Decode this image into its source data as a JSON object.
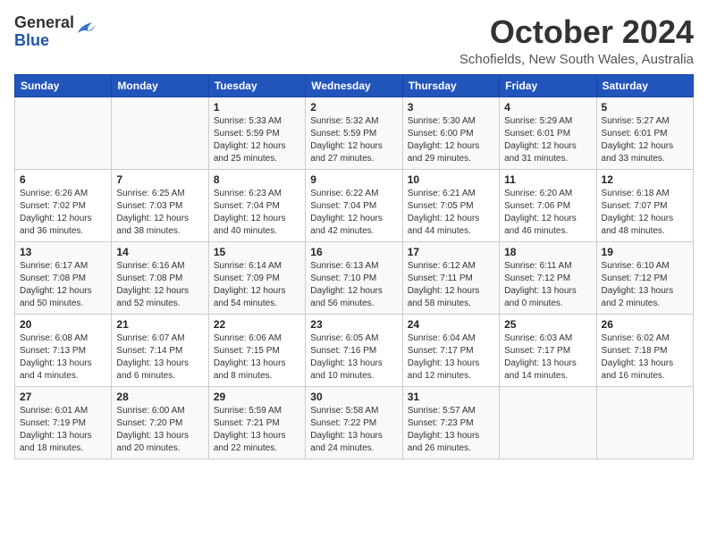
{
  "header": {
    "logo_general": "General",
    "logo_blue": "Blue",
    "title": "October 2024",
    "location": "Schofields, New South Wales, Australia"
  },
  "days_of_week": [
    "Sunday",
    "Monday",
    "Tuesday",
    "Wednesday",
    "Thursday",
    "Friday",
    "Saturday"
  ],
  "weeks": [
    [
      {
        "day": "",
        "info": ""
      },
      {
        "day": "",
        "info": ""
      },
      {
        "day": "1",
        "info": "Sunrise: 5:33 AM\nSunset: 5:59 PM\nDaylight: 12 hours\nand 25 minutes."
      },
      {
        "day": "2",
        "info": "Sunrise: 5:32 AM\nSunset: 5:59 PM\nDaylight: 12 hours\nand 27 minutes."
      },
      {
        "day": "3",
        "info": "Sunrise: 5:30 AM\nSunset: 6:00 PM\nDaylight: 12 hours\nand 29 minutes."
      },
      {
        "day": "4",
        "info": "Sunrise: 5:29 AM\nSunset: 6:01 PM\nDaylight: 12 hours\nand 31 minutes."
      },
      {
        "day": "5",
        "info": "Sunrise: 5:27 AM\nSunset: 6:01 PM\nDaylight: 12 hours\nand 33 minutes."
      }
    ],
    [
      {
        "day": "6",
        "info": "Sunrise: 6:26 AM\nSunset: 7:02 PM\nDaylight: 12 hours\nand 36 minutes."
      },
      {
        "day": "7",
        "info": "Sunrise: 6:25 AM\nSunset: 7:03 PM\nDaylight: 12 hours\nand 38 minutes."
      },
      {
        "day": "8",
        "info": "Sunrise: 6:23 AM\nSunset: 7:04 PM\nDaylight: 12 hours\nand 40 minutes."
      },
      {
        "day": "9",
        "info": "Sunrise: 6:22 AM\nSunset: 7:04 PM\nDaylight: 12 hours\nand 42 minutes."
      },
      {
        "day": "10",
        "info": "Sunrise: 6:21 AM\nSunset: 7:05 PM\nDaylight: 12 hours\nand 44 minutes."
      },
      {
        "day": "11",
        "info": "Sunrise: 6:20 AM\nSunset: 7:06 PM\nDaylight: 12 hours\nand 46 minutes."
      },
      {
        "day": "12",
        "info": "Sunrise: 6:18 AM\nSunset: 7:07 PM\nDaylight: 12 hours\nand 48 minutes."
      }
    ],
    [
      {
        "day": "13",
        "info": "Sunrise: 6:17 AM\nSunset: 7:08 PM\nDaylight: 12 hours\nand 50 minutes."
      },
      {
        "day": "14",
        "info": "Sunrise: 6:16 AM\nSunset: 7:08 PM\nDaylight: 12 hours\nand 52 minutes."
      },
      {
        "day": "15",
        "info": "Sunrise: 6:14 AM\nSunset: 7:09 PM\nDaylight: 12 hours\nand 54 minutes."
      },
      {
        "day": "16",
        "info": "Sunrise: 6:13 AM\nSunset: 7:10 PM\nDaylight: 12 hours\nand 56 minutes."
      },
      {
        "day": "17",
        "info": "Sunrise: 6:12 AM\nSunset: 7:11 PM\nDaylight: 12 hours\nand 58 minutes."
      },
      {
        "day": "18",
        "info": "Sunrise: 6:11 AM\nSunset: 7:12 PM\nDaylight: 13 hours\nand 0 minutes."
      },
      {
        "day": "19",
        "info": "Sunrise: 6:10 AM\nSunset: 7:12 PM\nDaylight: 13 hours\nand 2 minutes."
      }
    ],
    [
      {
        "day": "20",
        "info": "Sunrise: 6:08 AM\nSunset: 7:13 PM\nDaylight: 13 hours\nand 4 minutes."
      },
      {
        "day": "21",
        "info": "Sunrise: 6:07 AM\nSunset: 7:14 PM\nDaylight: 13 hours\nand 6 minutes."
      },
      {
        "day": "22",
        "info": "Sunrise: 6:06 AM\nSunset: 7:15 PM\nDaylight: 13 hours\nand 8 minutes."
      },
      {
        "day": "23",
        "info": "Sunrise: 6:05 AM\nSunset: 7:16 PM\nDaylight: 13 hours\nand 10 minutes."
      },
      {
        "day": "24",
        "info": "Sunrise: 6:04 AM\nSunset: 7:17 PM\nDaylight: 13 hours\nand 12 minutes."
      },
      {
        "day": "25",
        "info": "Sunrise: 6:03 AM\nSunset: 7:17 PM\nDaylight: 13 hours\nand 14 minutes."
      },
      {
        "day": "26",
        "info": "Sunrise: 6:02 AM\nSunset: 7:18 PM\nDaylight: 13 hours\nand 16 minutes."
      }
    ],
    [
      {
        "day": "27",
        "info": "Sunrise: 6:01 AM\nSunset: 7:19 PM\nDaylight: 13 hours\nand 18 minutes."
      },
      {
        "day": "28",
        "info": "Sunrise: 6:00 AM\nSunset: 7:20 PM\nDaylight: 13 hours\nand 20 minutes."
      },
      {
        "day": "29",
        "info": "Sunrise: 5:59 AM\nSunset: 7:21 PM\nDaylight: 13 hours\nand 22 minutes."
      },
      {
        "day": "30",
        "info": "Sunrise: 5:58 AM\nSunset: 7:22 PM\nDaylight: 13 hours\nand 24 minutes."
      },
      {
        "day": "31",
        "info": "Sunrise: 5:57 AM\nSunset: 7:23 PM\nDaylight: 13 hours\nand 26 minutes."
      },
      {
        "day": "",
        "info": ""
      },
      {
        "day": "",
        "info": ""
      }
    ]
  ]
}
